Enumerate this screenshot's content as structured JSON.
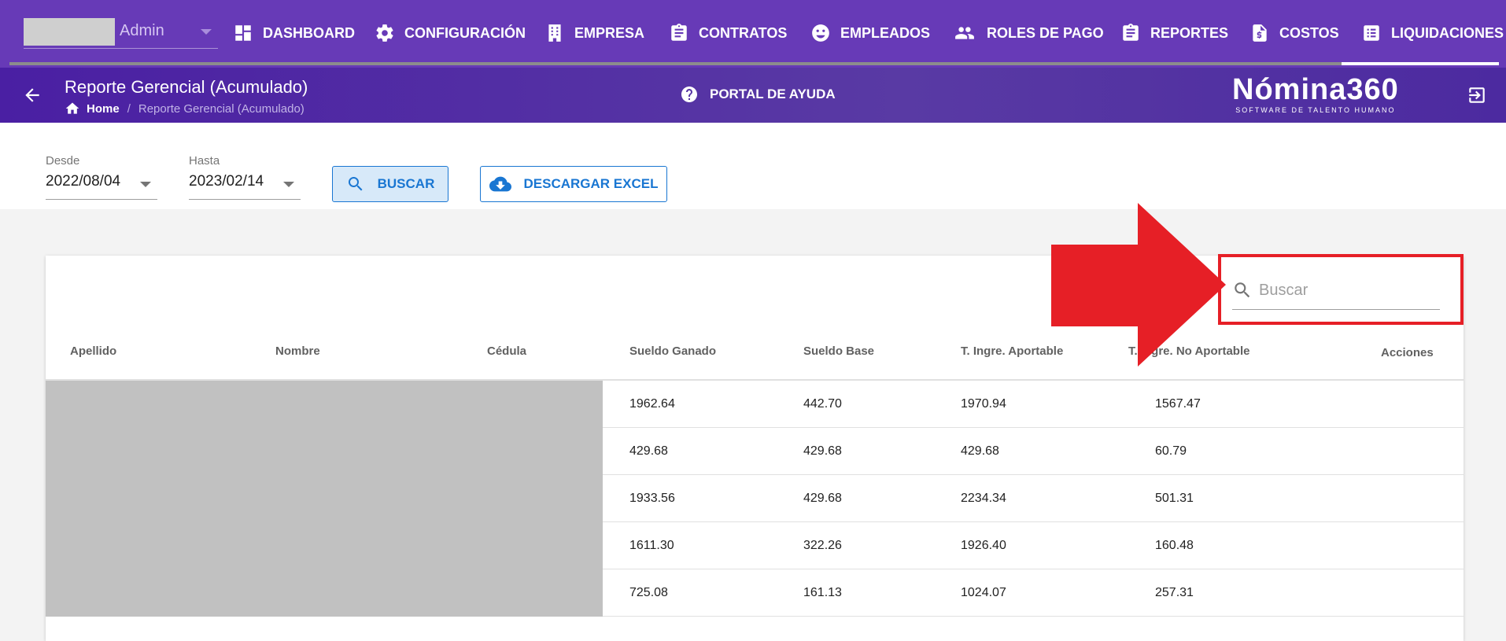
{
  "topnav": {
    "user": {
      "name": "Admin"
    },
    "items": [
      {
        "label": "DASHBOARD",
        "icon": "dashboard-icon"
      },
      {
        "label": "CONFIGURACIÓN",
        "icon": "gear-icon"
      },
      {
        "label": "EMPRESA",
        "icon": "building-icon"
      },
      {
        "label": "CONTRATOS",
        "icon": "clipboard-icon"
      },
      {
        "label": "EMPLEADOS",
        "icon": "face-icon"
      },
      {
        "label": "ROLES DE PAGO",
        "icon": "group-icon"
      },
      {
        "label": "REPORTES",
        "icon": "clipboard-icon"
      },
      {
        "label": "COSTOS",
        "icon": "invoice-icon"
      },
      {
        "label": "LIQUIDACIONES",
        "icon": "list-icon"
      }
    ],
    "active": "LIQUIDACIONES",
    "accent": "#673ab7"
  },
  "subheader": {
    "title": "Reporte Gerencial (Acumulado)",
    "breadcrumb": {
      "home": "Home",
      "current": "Reporte Gerencial (Acumulado)"
    },
    "help_label": "PORTAL DE AYUDA",
    "brand": {
      "name": "Nómina360",
      "tagline": "SOFTWARE DE TALENTO HUMANO"
    }
  },
  "filters": {
    "from": {
      "label": "Desde",
      "value": "2022/08/04"
    },
    "to": {
      "label": "Hasta",
      "value": "2023/02/14"
    },
    "search_button": "BUSCAR",
    "excel_button": "DESCARGAR EXCEL",
    "button_color": "#1976d2"
  },
  "table": {
    "search_placeholder": "Buscar",
    "columns": [
      "Apellido",
      "Nombre",
      "Cédula",
      "Sueldo Ganado",
      "Sueldo Base",
      "T. Ingre. Aportable",
      "T. Ingre. No Aportable",
      "Acciones"
    ],
    "rows": [
      {
        "sueldo_ganado": "1962.64",
        "sueldo_base": "442.70",
        "aportable": "1970.94",
        "no_aportable": "1567.47"
      },
      {
        "sueldo_ganado": "429.68",
        "sueldo_base": "429.68",
        "aportable": "429.68",
        "no_aportable": "60.79"
      },
      {
        "sueldo_ganado": "1933.56",
        "sueldo_base": "429.68",
        "aportable": "2234.34",
        "no_aportable": "501.31"
      },
      {
        "sueldo_ganado": "1611.30",
        "sueldo_base": "322.26",
        "aportable": "1926.40",
        "no_aportable": "160.48"
      },
      {
        "sueldo_ganado": "725.08",
        "sueldo_base": "161.13",
        "aportable": "1024.07",
        "no_aportable": "257.31"
      }
    ]
  },
  "annotation": {
    "color": "#e61f26"
  }
}
